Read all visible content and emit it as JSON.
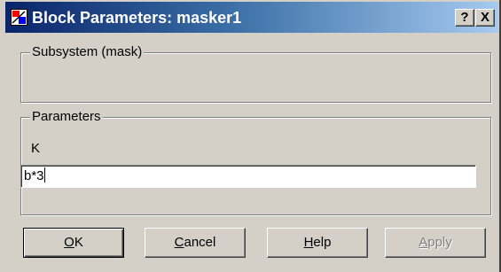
{
  "window": {
    "title": "Block Parameters: masker1",
    "help_caption": "?",
    "close_caption": "X"
  },
  "subsystem_group": {
    "label": "Subsystem (mask)"
  },
  "parameters_group": {
    "label": "Parameters",
    "field_label": "K",
    "field_value": "b*3"
  },
  "buttons": {
    "ok": {
      "mnemonic": "O",
      "rest": "K",
      "enabled": true
    },
    "cancel": {
      "mnemonic": "C",
      "rest": "ancel",
      "enabled": true
    },
    "help": {
      "mnemonic": "H",
      "rest": "elp",
      "enabled": true
    },
    "apply": {
      "mnemonic": "A",
      "rest": "pply",
      "enabled": false
    }
  },
  "colors": {
    "title_gradient_start": "#0a246a",
    "title_gradient_end": "#a6caf0",
    "dialog_face": "#d4d0c8",
    "disabled_text": "#808080"
  },
  "icons": {
    "window": "block-parameters-icon"
  }
}
